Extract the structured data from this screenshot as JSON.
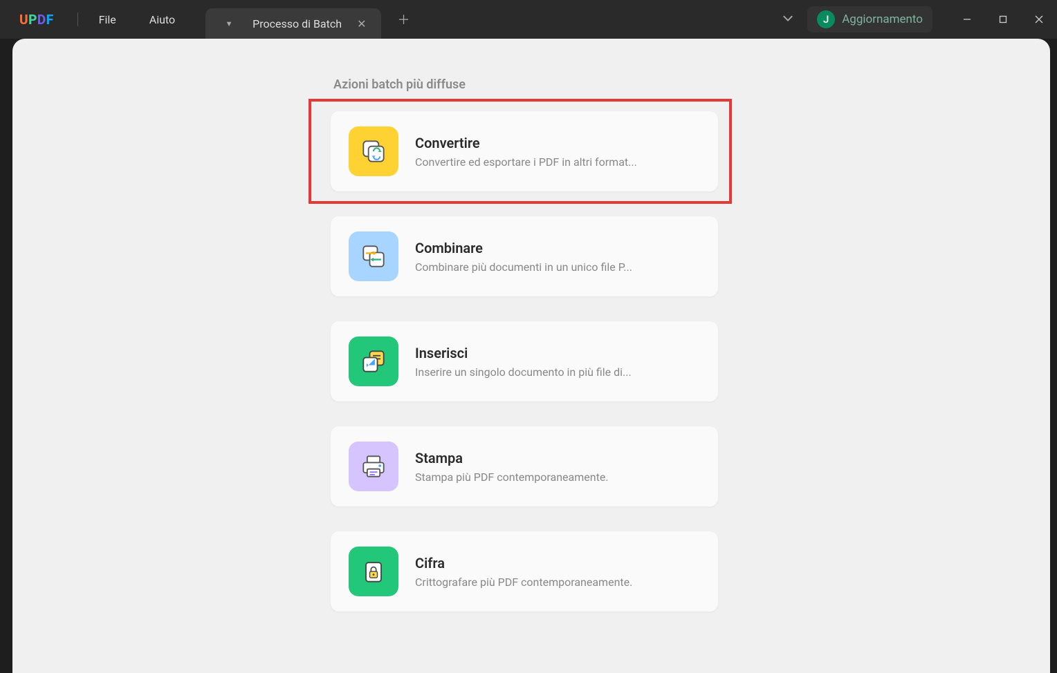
{
  "app": {
    "logo": "UPDF"
  },
  "menu": {
    "file": "File",
    "help": "Aiuto"
  },
  "tab": {
    "title": "Processo di Batch"
  },
  "user": {
    "initial": "J",
    "label": "Aggiornamento"
  },
  "section": {
    "heading": "Azioni batch più diffuse"
  },
  "cards": {
    "convert": {
      "title": "Convertire",
      "desc": "Convertire ed esportare i PDF in altri format..."
    },
    "combine": {
      "title": "Combinare",
      "desc": "Combinare più documenti in un unico file P..."
    },
    "insert": {
      "title": "Inserisci",
      "desc": "Inserire un singolo documento in più file di..."
    },
    "print": {
      "title": "Stampa",
      "desc": "Stampa più PDF contemporaneamente."
    },
    "encrypt": {
      "title": "Cifra",
      "desc": "Crittografare più PDF contemporaneamente."
    }
  }
}
